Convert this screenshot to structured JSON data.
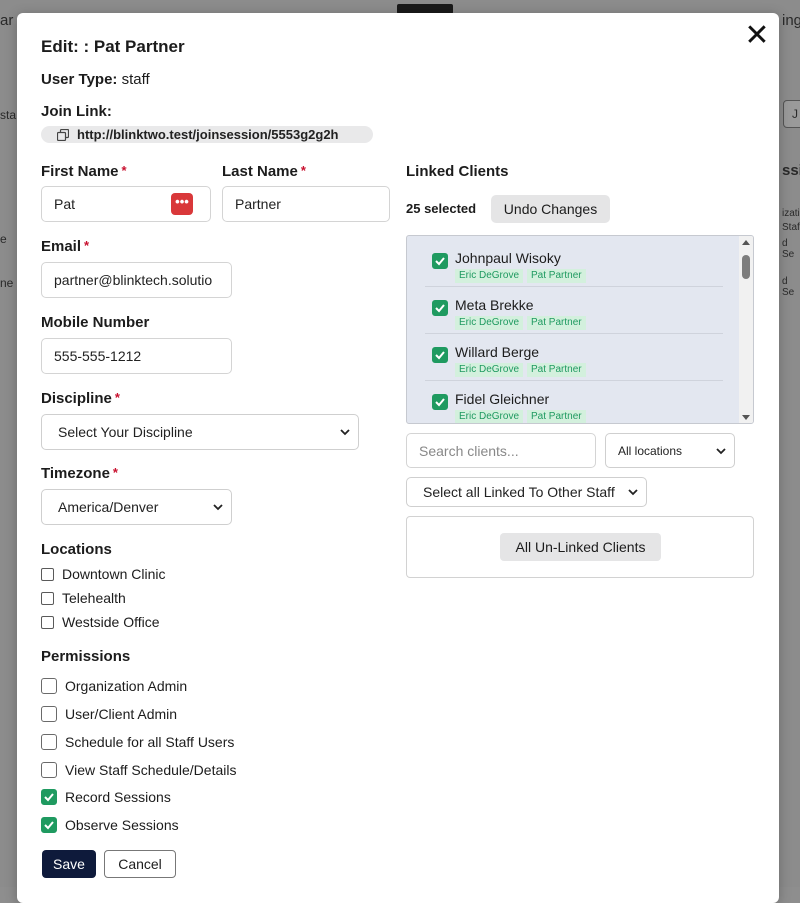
{
  "background": {
    "fragments": [
      "ar",
      "sta",
      "e",
      "ne",
      "ing",
      "ssi",
      "izati",
      "Staf",
      "d Se",
      "d Se",
      "J"
    ]
  },
  "modal": {
    "title": "Edit: : Pat Partner",
    "close_glyph": "✕",
    "user_type_label": "User Type:",
    "user_type_value": "staff",
    "join_link_label": "Join Link:",
    "join_link_url": "http://blinktwo.test/joinsession/5553g2g2h",
    "first_name": {
      "label": "First Name",
      "required": "*",
      "value": "Pat",
      "pw_icon": "•••"
    },
    "last_name": {
      "label": "Last Name",
      "required": "*",
      "value": "Partner"
    },
    "email": {
      "label": "Email",
      "required": "*",
      "value": "partner@blinktech.solutio"
    },
    "mobile": {
      "label": "Mobile Number",
      "value": "555-555-1212"
    },
    "discipline": {
      "label": "Discipline",
      "required": "*",
      "value": "Select Your Discipline"
    },
    "timezone": {
      "label": "Timezone",
      "required": "*",
      "value": "America/Denver"
    },
    "locations": {
      "label": "Locations",
      "items": [
        {
          "label": "Downtown Clinic",
          "checked": false
        },
        {
          "label": "Telehealth",
          "checked": false
        },
        {
          "label": "Westside Office",
          "checked": false
        }
      ]
    },
    "permissions": {
      "label": "Permissions",
      "items": [
        {
          "label": "Organization Admin",
          "checked": false
        },
        {
          "label": "User/Client Admin",
          "checked": false
        },
        {
          "label": "Schedule for all Staff Users",
          "checked": false
        },
        {
          "label": "View Staff Schedule/Details",
          "checked": false
        },
        {
          "label": "Record Sessions",
          "checked": true
        },
        {
          "label": "Observe Sessions",
          "checked": true
        }
      ]
    },
    "save_label": "Save",
    "cancel_label": "Cancel",
    "linked_clients": {
      "label": "Linked Clients",
      "selected_count": "25 selected",
      "undo_label": "Undo Changes",
      "clients": [
        {
          "name": "Johnpaul Wisoky",
          "tags": [
            "Eric DeGrove",
            "Pat Partner"
          ],
          "checked": true
        },
        {
          "name": "Meta Brekke",
          "tags": [
            "Eric DeGrove",
            "Pat Partner"
          ],
          "checked": true
        },
        {
          "name": "Willard Berge",
          "tags": [
            "Eric DeGrove",
            "Pat Partner"
          ],
          "checked": true
        },
        {
          "name": "Fidel Gleichner",
          "tags": [
            "Eric DeGrove",
            "Pat Partner"
          ],
          "checked": true
        }
      ],
      "search_placeholder": "Search clients...",
      "locations_filter": "All locations",
      "linked_other_staff": "Select all Linked To Other Staff",
      "unlinked_label": "All Un-Linked Clients"
    }
  },
  "colors": {
    "check_green": "#1f9a60",
    "tag_bg": "#d3f0dd",
    "save_bg": "#0e1a3b",
    "required_red": "#c8102e",
    "pw_badge": "#d9383a"
  }
}
